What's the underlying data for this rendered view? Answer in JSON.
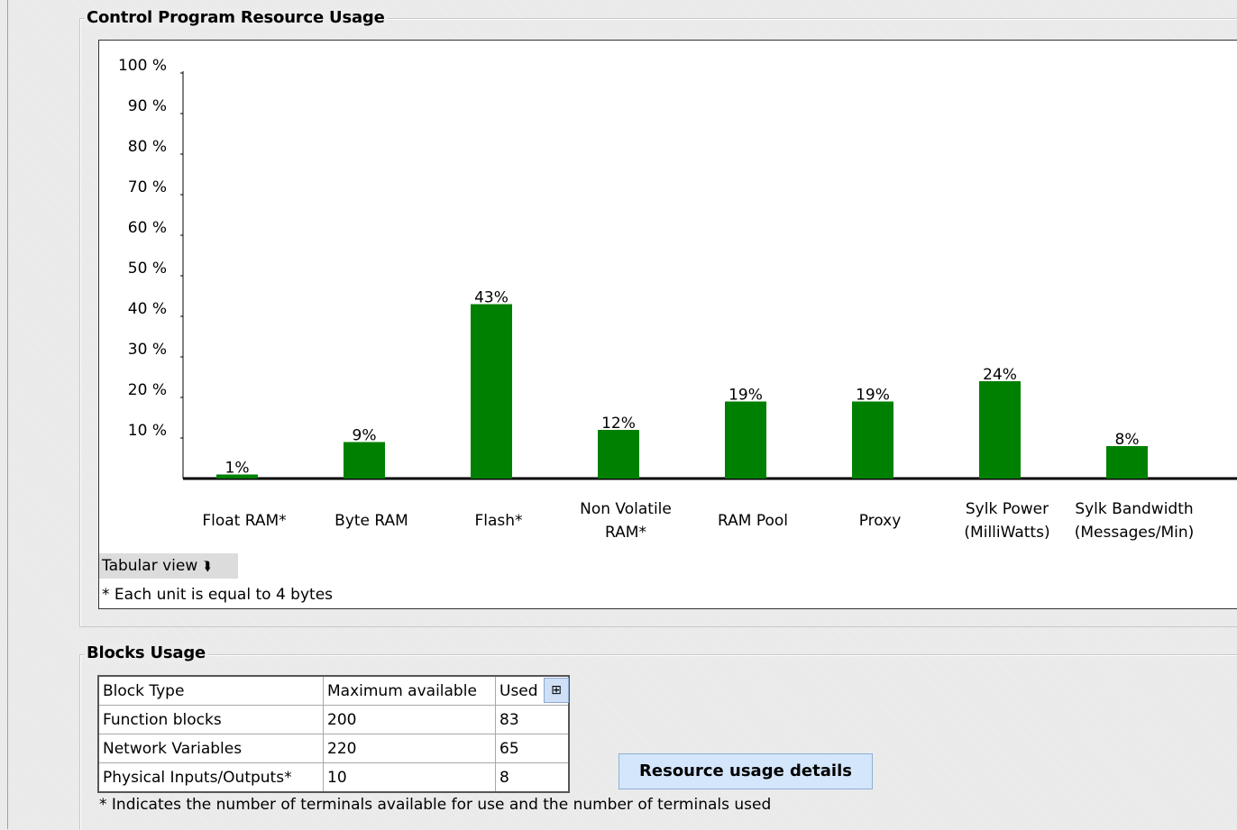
{
  "resource_section": {
    "title": "Control Program Resource Usage"
  },
  "chart_data": {
    "type": "bar",
    "categories": [
      "Float RAM*",
      "Byte RAM",
      "Flash*",
      "Non Volatile RAM*",
      "RAM Pool",
      "Proxy",
      "Sylk Power (MilliWatts)",
      "Sylk Bandwidth (Messages/Min)"
    ],
    "category_lines": [
      [
        "Float RAM*"
      ],
      [
        "Byte RAM"
      ],
      [
        "Flash*"
      ],
      [
        "Non Volatile",
        "RAM*"
      ],
      [
        "RAM Pool"
      ],
      [
        "Proxy"
      ],
      [
        "Sylk Power",
        "(MilliWatts)"
      ],
      [
        "Sylk Bandwidth",
        "(Messages/Min)"
      ]
    ],
    "values": [
      1,
      9,
      43,
      12,
      19,
      19,
      24,
      8
    ],
    "value_labels": [
      "1%",
      "9%",
      "43%",
      "12%",
      "19%",
      "19%",
      "24%",
      "8%"
    ],
    "y_ticks": [
      "10 %",
      "20 %",
      "30 %",
      "40 %",
      "50 %",
      "60 %",
      "70 %",
      "80 %",
      "90 %",
      "100 %"
    ],
    "ylim": [
      0,
      100
    ],
    "bar_color": "#008000",
    "grid": false
  },
  "tabular_view": {
    "label": "Tabular view",
    "icon": "double-chevron-down-icon"
  },
  "resource_footnote": "* Each unit is equal to 4 bytes",
  "blocks_section": {
    "title": "Blocks Usage",
    "columns": [
      "Block Type",
      "Maximum available",
      "Used"
    ],
    "rows": [
      [
        "Function blocks",
        "200",
        "83"
      ],
      [
        "Network Variables",
        "220",
        "65"
      ],
      [
        "Physical Inputs/Outputs*",
        "10",
        "8"
      ]
    ],
    "column_menu_icon": "column-chooser-icon",
    "footnote": "* Indicates the number of terminals available for use and the number of terminals used"
  },
  "details_button": {
    "label": "Resource usage details"
  }
}
